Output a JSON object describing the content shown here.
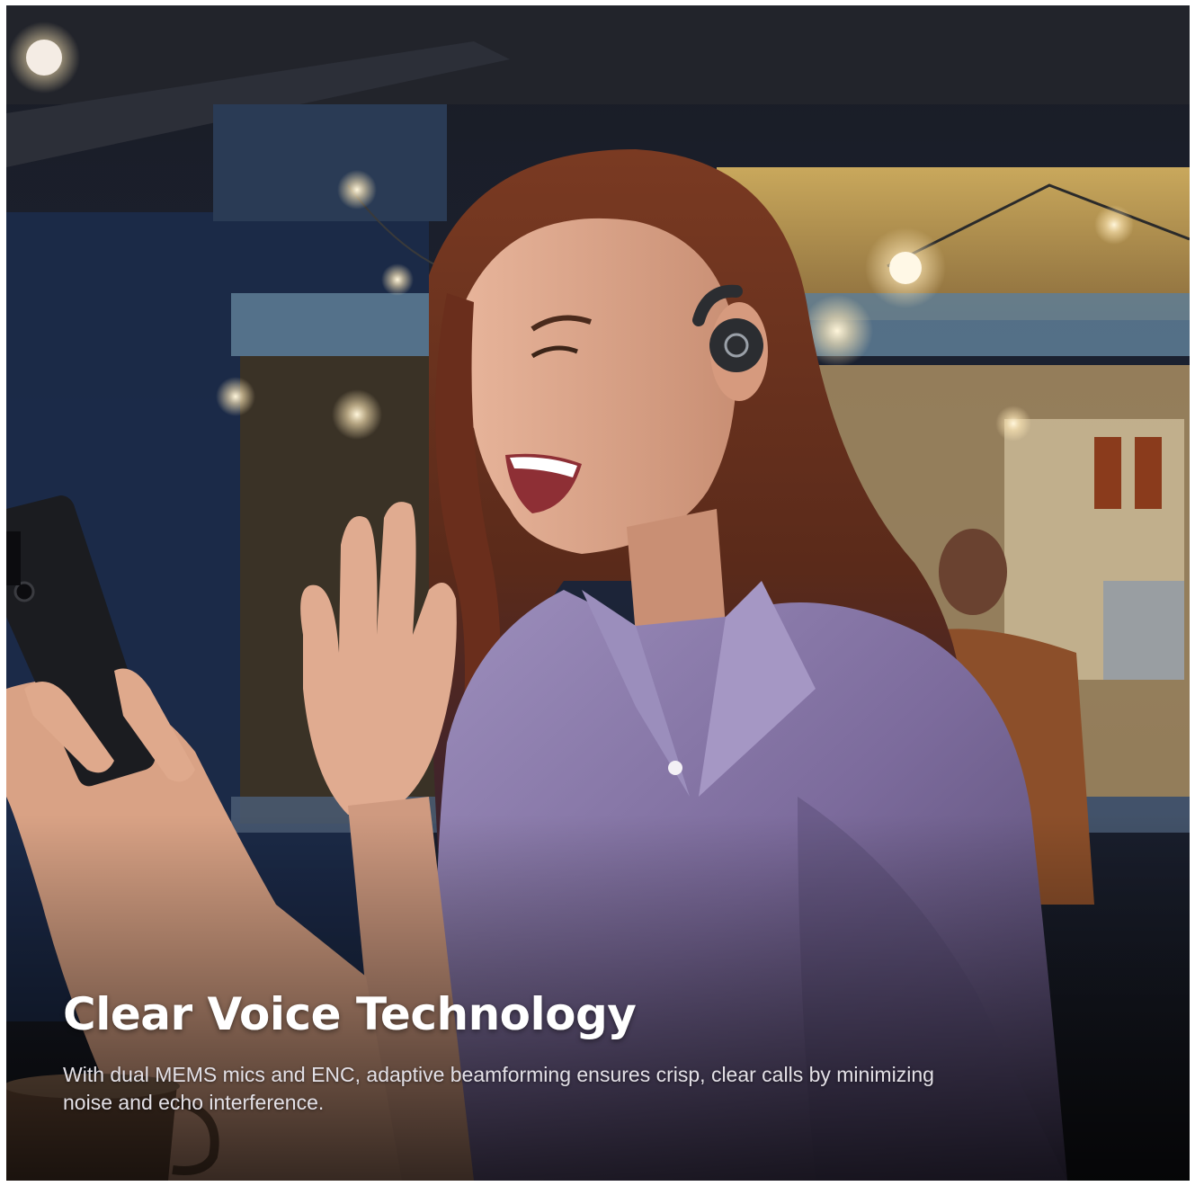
{
  "hero": {
    "headline": "Clear Voice Technology",
    "body": "With dual MEMS mics and ENC, adaptive beamforming ensures crisp, clear calls by minimizing noise and echo interference."
  },
  "image": {
    "subject": "woman-waving-at-phone-wearing-open-ear-earbud",
    "setting": "night-street-food-stall",
    "shirt_color": "#7f6e9e",
    "hair_color": "#6b2f1c",
    "earbud_color": "#2b2d31",
    "stall_accent": "#d8b866"
  }
}
